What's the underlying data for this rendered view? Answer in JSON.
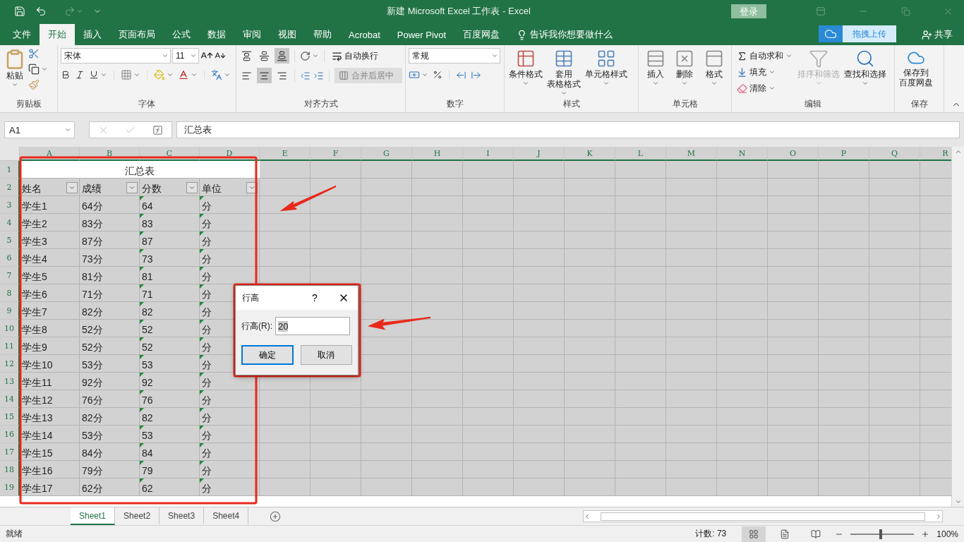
{
  "title_bar": {
    "title": "新建 Microsoft Excel 工作表  -  Excel",
    "login": "登录"
  },
  "tabs": [
    {
      "label": "文件",
      "selected": false
    },
    {
      "label": "开始",
      "selected": true
    },
    {
      "label": "插入",
      "selected": false
    },
    {
      "label": "页面布局",
      "selected": false
    },
    {
      "label": "公式",
      "selected": false
    },
    {
      "label": "数据",
      "selected": false
    },
    {
      "label": "审阅",
      "selected": false
    },
    {
      "label": "视图",
      "selected": false
    },
    {
      "label": "帮助",
      "selected": false
    },
    {
      "label": "Acrobat",
      "selected": false
    },
    {
      "label": "Power Pivot",
      "selected": false
    },
    {
      "label": "百度网盘",
      "selected": false
    }
  ],
  "tell_me": "告诉我你想要做什么",
  "upload_button": "拖拽上传",
  "share": "共享",
  "ribbon": {
    "clipboard": {
      "paste": "粘贴",
      "label": "剪贴板"
    },
    "font": {
      "font_name": "宋体",
      "font_size": "11",
      "label": "字体"
    },
    "alignment": {
      "wrap_text": "自动换行",
      "merge": {
        "label": "合并后居中",
        "disabled": true
      },
      "label": "对齐方式"
    },
    "number": {
      "format": "常规",
      "label": "数字"
    },
    "styles": {
      "buttons": [
        {
          "lines": [
            "条件格式"
          ],
          "kind": "conditional"
        },
        {
          "lines": [
            "套用",
            "表格格式"
          ],
          "kind": "table"
        },
        {
          "lines": [
            "单元格样式"
          ],
          "kind": "cell"
        }
      ],
      "label": "样式"
    },
    "cells": {
      "buttons": [
        {
          "label": "插入",
          "kind": "insert"
        },
        {
          "label": "删除",
          "kind": "delete"
        },
        {
          "label": "格式",
          "kind": "format"
        }
      ],
      "label": "单元格"
    },
    "editing": {
      "small_items": [
        {
          "label": "自动求和",
          "kind": "sum"
        },
        {
          "label": "填充",
          "kind": "fill"
        },
        {
          "label": "清除",
          "kind": "clear"
        }
      ],
      "large_items": [
        {
          "label": "排序和筛选",
          "kind": "sort",
          "disabled": true
        },
        {
          "label": "查找和选择",
          "kind": "find",
          "disabled": false
        }
      ],
      "label": "编辑"
    },
    "save": {
      "lines": [
        "保存到",
        "百度网盘"
      ],
      "label": "保存"
    }
  },
  "formula_bar": {
    "name_box": "A1",
    "formula": "汇总表"
  },
  "sheet": {
    "all_selected": true,
    "columns": [
      "A",
      "B",
      "C",
      "D",
      "E",
      "F",
      "G",
      "H",
      "I",
      "J",
      "K",
      "L",
      "M",
      "N",
      "O",
      "P",
      "Q",
      "R"
    ],
    "rows": [
      {
        "number": "1",
        "kind": "title",
        "title": "汇总表"
      },
      {
        "number": "2",
        "kind": "header",
        "cells": [
          {
            "text": "姓名",
            "flag": false
          },
          {
            "text": "成绩",
            "flag": false
          },
          {
            "text": "分数",
            "flag": false
          },
          {
            "text": "单位",
            "flag": false
          }
        ]
      },
      {
        "number": "3",
        "kind": "data",
        "cells": [
          {
            "text": "学生1",
            "flag": false
          },
          {
            "text": "64分",
            "flag": false
          },
          {
            "text": "64",
            "flag": true
          },
          {
            "text": "分",
            "flag": true
          }
        ]
      },
      {
        "number": "4",
        "kind": "data",
        "cells": [
          {
            "text": "学生2",
            "flag": false
          },
          {
            "text": "83分",
            "flag": false
          },
          {
            "text": "83",
            "flag": true
          },
          {
            "text": "分",
            "flag": true
          }
        ]
      },
      {
        "number": "5",
        "kind": "data",
        "cells": [
          {
            "text": "学生3",
            "flag": false
          },
          {
            "text": "87分",
            "flag": false
          },
          {
            "text": "87",
            "flag": true
          },
          {
            "text": "分",
            "flag": true
          }
        ]
      },
      {
        "number": "6",
        "kind": "data",
        "cells": [
          {
            "text": "学生4",
            "flag": false
          },
          {
            "text": "73分",
            "flag": false
          },
          {
            "text": "73",
            "flag": true
          },
          {
            "text": "分",
            "flag": true
          }
        ]
      },
      {
        "number": "7",
        "kind": "data",
        "cells": [
          {
            "text": "学生5",
            "flag": false
          },
          {
            "text": "81分",
            "flag": false
          },
          {
            "text": "81",
            "flag": true
          },
          {
            "text": "分",
            "flag": true
          }
        ]
      },
      {
        "number": "8",
        "kind": "data",
        "cells": [
          {
            "text": "学生6",
            "flag": false
          },
          {
            "text": "71分",
            "flag": false
          },
          {
            "text": "71",
            "flag": true
          },
          {
            "text": "分",
            "flag": true
          }
        ]
      },
      {
        "number": "9",
        "kind": "data",
        "cells": [
          {
            "text": "学生7",
            "flag": false
          },
          {
            "text": "82分",
            "flag": false
          },
          {
            "text": "82",
            "flag": true
          },
          {
            "text": "分",
            "flag": true
          }
        ]
      },
      {
        "number": "10",
        "kind": "data",
        "cells": [
          {
            "text": "学生8",
            "flag": false
          },
          {
            "text": "52分",
            "flag": false
          },
          {
            "text": "52",
            "flag": true
          },
          {
            "text": "分",
            "flag": true
          }
        ]
      },
      {
        "number": "11",
        "kind": "data",
        "cells": [
          {
            "text": "学生9",
            "flag": false
          },
          {
            "text": "52分",
            "flag": false
          },
          {
            "text": "52",
            "flag": true
          },
          {
            "text": "分",
            "flag": true
          }
        ]
      },
      {
        "number": "12",
        "kind": "data",
        "cells": [
          {
            "text": "学生10",
            "flag": false
          },
          {
            "text": "53分",
            "flag": false
          },
          {
            "text": "53",
            "flag": true
          },
          {
            "text": "分",
            "flag": true
          }
        ]
      },
      {
        "number": "13",
        "kind": "data",
        "cells": [
          {
            "text": "学生11",
            "flag": false
          },
          {
            "text": "92分",
            "flag": false
          },
          {
            "text": "92",
            "flag": true
          },
          {
            "text": "分",
            "flag": true
          }
        ]
      },
      {
        "number": "14",
        "kind": "data",
        "cells": [
          {
            "text": "学生12",
            "flag": false
          },
          {
            "text": "76分",
            "flag": false
          },
          {
            "text": "76",
            "flag": true
          },
          {
            "text": "分",
            "flag": true
          }
        ]
      },
      {
        "number": "15",
        "kind": "data",
        "cells": [
          {
            "text": "学生13",
            "flag": false
          },
          {
            "text": "82分",
            "flag": false
          },
          {
            "text": "82",
            "flag": true
          },
          {
            "text": "分",
            "flag": true
          }
        ]
      },
      {
        "number": "16",
        "kind": "data",
        "cells": [
          {
            "text": "学生14",
            "flag": false
          },
          {
            "text": "53分",
            "flag": false
          },
          {
            "text": "53",
            "flag": true
          },
          {
            "text": "分",
            "flag": true
          }
        ]
      },
      {
        "number": "17",
        "kind": "data",
        "cells": [
          {
            "text": "学生15",
            "flag": false
          },
          {
            "text": "84分",
            "flag": false
          },
          {
            "text": "84",
            "flag": true
          },
          {
            "text": "分",
            "flag": true
          }
        ]
      },
      {
        "number": "18",
        "kind": "data",
        "cells": [
          {
            "text": "学生16",
            "flag": false
          },
          {
            "text": "79分",
            "flag": false
          },
          {
            "text": "79",
            "flag": true
          },
          {
            "text": "分",
            "flag": true
          }
        ]
      },
      {
        "number": "19",
        "kind": "data",
        "cells": [
          {
            "text": "学生17",
            "flag": false
          },
          {
            "text": "62分",
            "flag": false
          },
          {
            "text": "62",
            "flag": true
          },
          {
            "text": "分",
            "flag": true
          }
        ]
      }
    ]
  },
  "dialog": {
    "title": "行高",
    "help": "?",
    "field_label": "行高(R):",
    "value": "20",
    "buttons": [
      {
        "label": "确定",
        "selected": true
      },
      {
        "label": "取消",
        "selected": false
      }
    ]
  },
  "sheet_tabs": [
    {
      "label": "Sheet1",
      "selected": true
    },
    {
      "label": "Sheet2",
      "selected": false
    },
    {
      "label": "Sheet3",
      "selected": false
    },
    {
      "label": "Sheet4",
      "selected": false
    }
  ],
  "status_bar": {
    "status": "就绪",
    "count": "计数: 73",
    "zoom": {
      "level": 0.48,
      "reading": "100%"
    }
  }
}
